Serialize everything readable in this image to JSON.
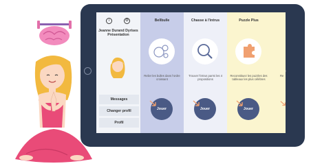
{
  "profile": {
    "info_icon": "i",
    "settings_icon": "⚙",
    "name": "Jeanne Durand Dyrises Présentation",
    "menu": [
      "Messages",
      "Changer profil",
      "Profil"
    ]
  },
  "games": [
    {
      "title": "Bellbulle",
      "description": "Relier les bulles dans l'ordre croissant",
      "play_label": "Jouer",
      "icon": "bubbles-icon"
    },
    {
      "title": "Chasse à l'intrus",
      "description": "Trouver l'intrus parmi les 4 propositions",
      "play_label": "Jouer",
      "icon": "magnifier-icon"
    },
    {
      "title": "Puzzle Plus",
      "description": "Reconstituez les puzzles des tableaux les plus célèbres",
      "play_label": "Jouer",
      "icon": "puzzle-icon"
    },
    {
      "title": "",
      "description": "Re",
      "play_label": "",
      "icon": ""
    }
  ],
  "colors": {
    "tablet_frame": "#2a3850",
    "play_button": "#4a5a85",
    "arrow": "#f0a070",
    "column_1": "#c7cde9",
    "column_3": "#fbf5cf"
  }
}
